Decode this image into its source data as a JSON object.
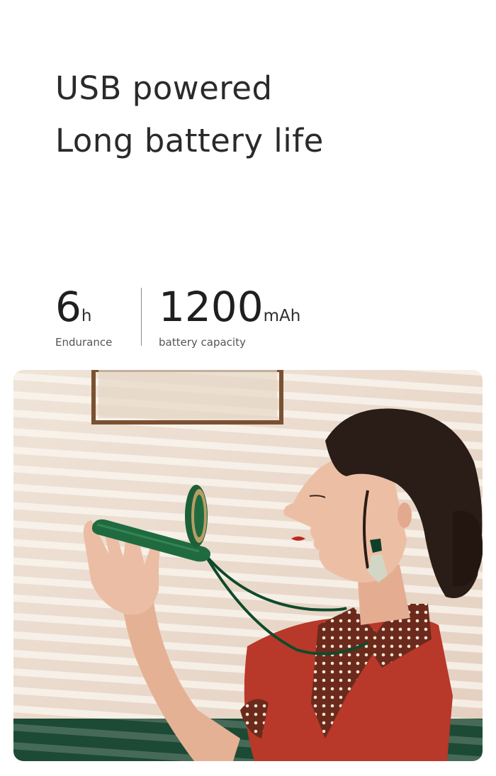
{
  "headline": {
    "line1": "USB powered",
    "line2": "Long battery life"
  },
  "specs": [
    {
      "value": "6",
      "unit": "h",
      "label": "Endurance"
    },
    {
      "value": "1200",
      "unit": "mAh",
      "label": "battery capacity"
    }
  ],
  "photo": {
    "subject": "person-holding-neck-fan-photo",
    "colors": {
      "wall": "#eadcce",
      "fan_green": "#1f6b3f",
      "shirt_red": "#b8382a",
      "hair": "#2a1c16",
      "skin": "#e9b89e",
      "floor_green": "#1c4a34"
    }
  }
}
